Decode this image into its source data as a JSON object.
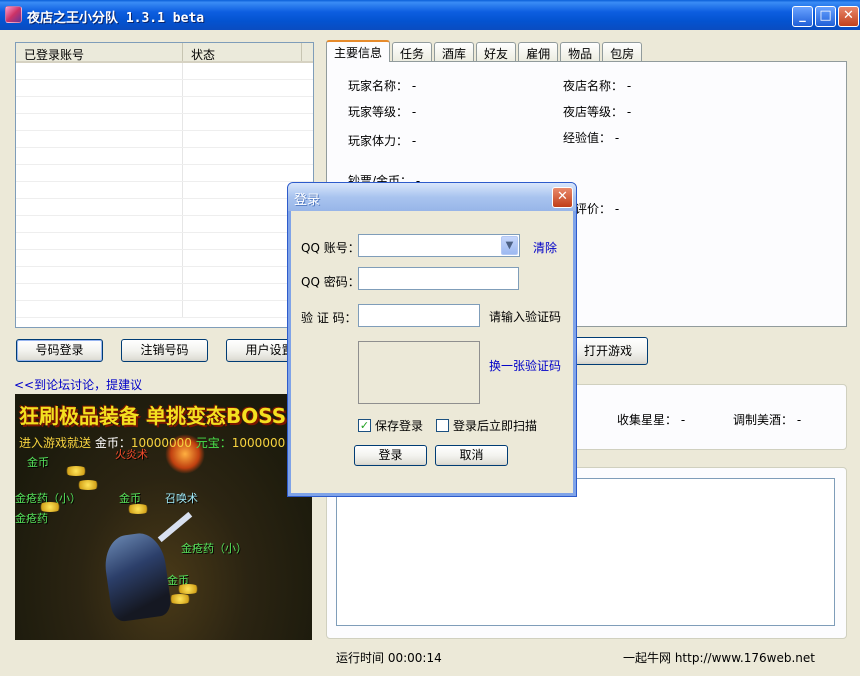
{
  "window": {
    "title": "夜店之王小分队 1.3.1 beta",
    "min_glyph": "_",
    "max_glyph": "□",
    "close_glyph": "✕"
  },
  "account_list": {
    "columns": [
      "已登录账号",
      "状态"
    ],
    "rows": []
  },
  "buttons": {
    "login": "号码登录",
    "logout": "注销号码",
    "user_settings": "用户设置",
    "start_game": "打开游戏"
  },
  "forum_link": "<<到论坛讨论，提建议",
  "ad": {
    "banner": "狂刷极品装备 单挑变态BOSS",
    "enter": "进入游戏就送",
    "gold_label": "金币：",
    "gold_value": "10000000",
    "yuanbao_label": "元宝：",
    "yuanbao_value": "1000000",
    "labels": [
      "金币",
      "火炎术",
      "金疮药（小）",
      "金币",
      "召唤术",
      "金疮药",
      "金疮药（小）",
      "金币"
    ]
  },
  "tabs": [
    "主要信息",
    "任务",
    "酒库",
    "好友",
    "雇佣",
    "物品",
    "包房"
  ],
  "active_tab": 0,
  "info": {
    "player_name": "玩家名称：  -",
    "club_name": "夜店名称：  -",
    "player_level": "玩家等级：  -",
    "club_level": "夜店等级：  -",
    "player_stamina": "玩家体力：  -",
    "exp": "经验值：    -",
    "money": "钞票/金币：  -",
    "daily_rating": "日评价：  -"
  },
  "stats": {
    "stars": "收集星星：  -",
    "wine": "调制美酒：  -"
  },
  "status": {
    "runtime": "运行时间 00:00:14",
    "site": "一起牛网 http://www.176web.net"
  },
  "login_dialog": {
    "title": "登录",
    "close_glyph": "✕",
    "qq_label": "QQ 账号：",
    "qq_value": "",
    "clear": "清除",
    "pwd_label": "QQ 密码：",
    "pwd_value": "",
    "captcha_label": "验 证 码：",
    "captcha_value": "",
    "captcha_hint": "请输入验证码",
    "change_captcha": "换一张验证码",
    "save_login": "保存登录",
    "save_login_checked": true,
    "scan_after_login": "登录后立即扫描",
    "scan_after_login_checked": false,
    "ok": "登录",
    "cancel": "取消"
  }
}
